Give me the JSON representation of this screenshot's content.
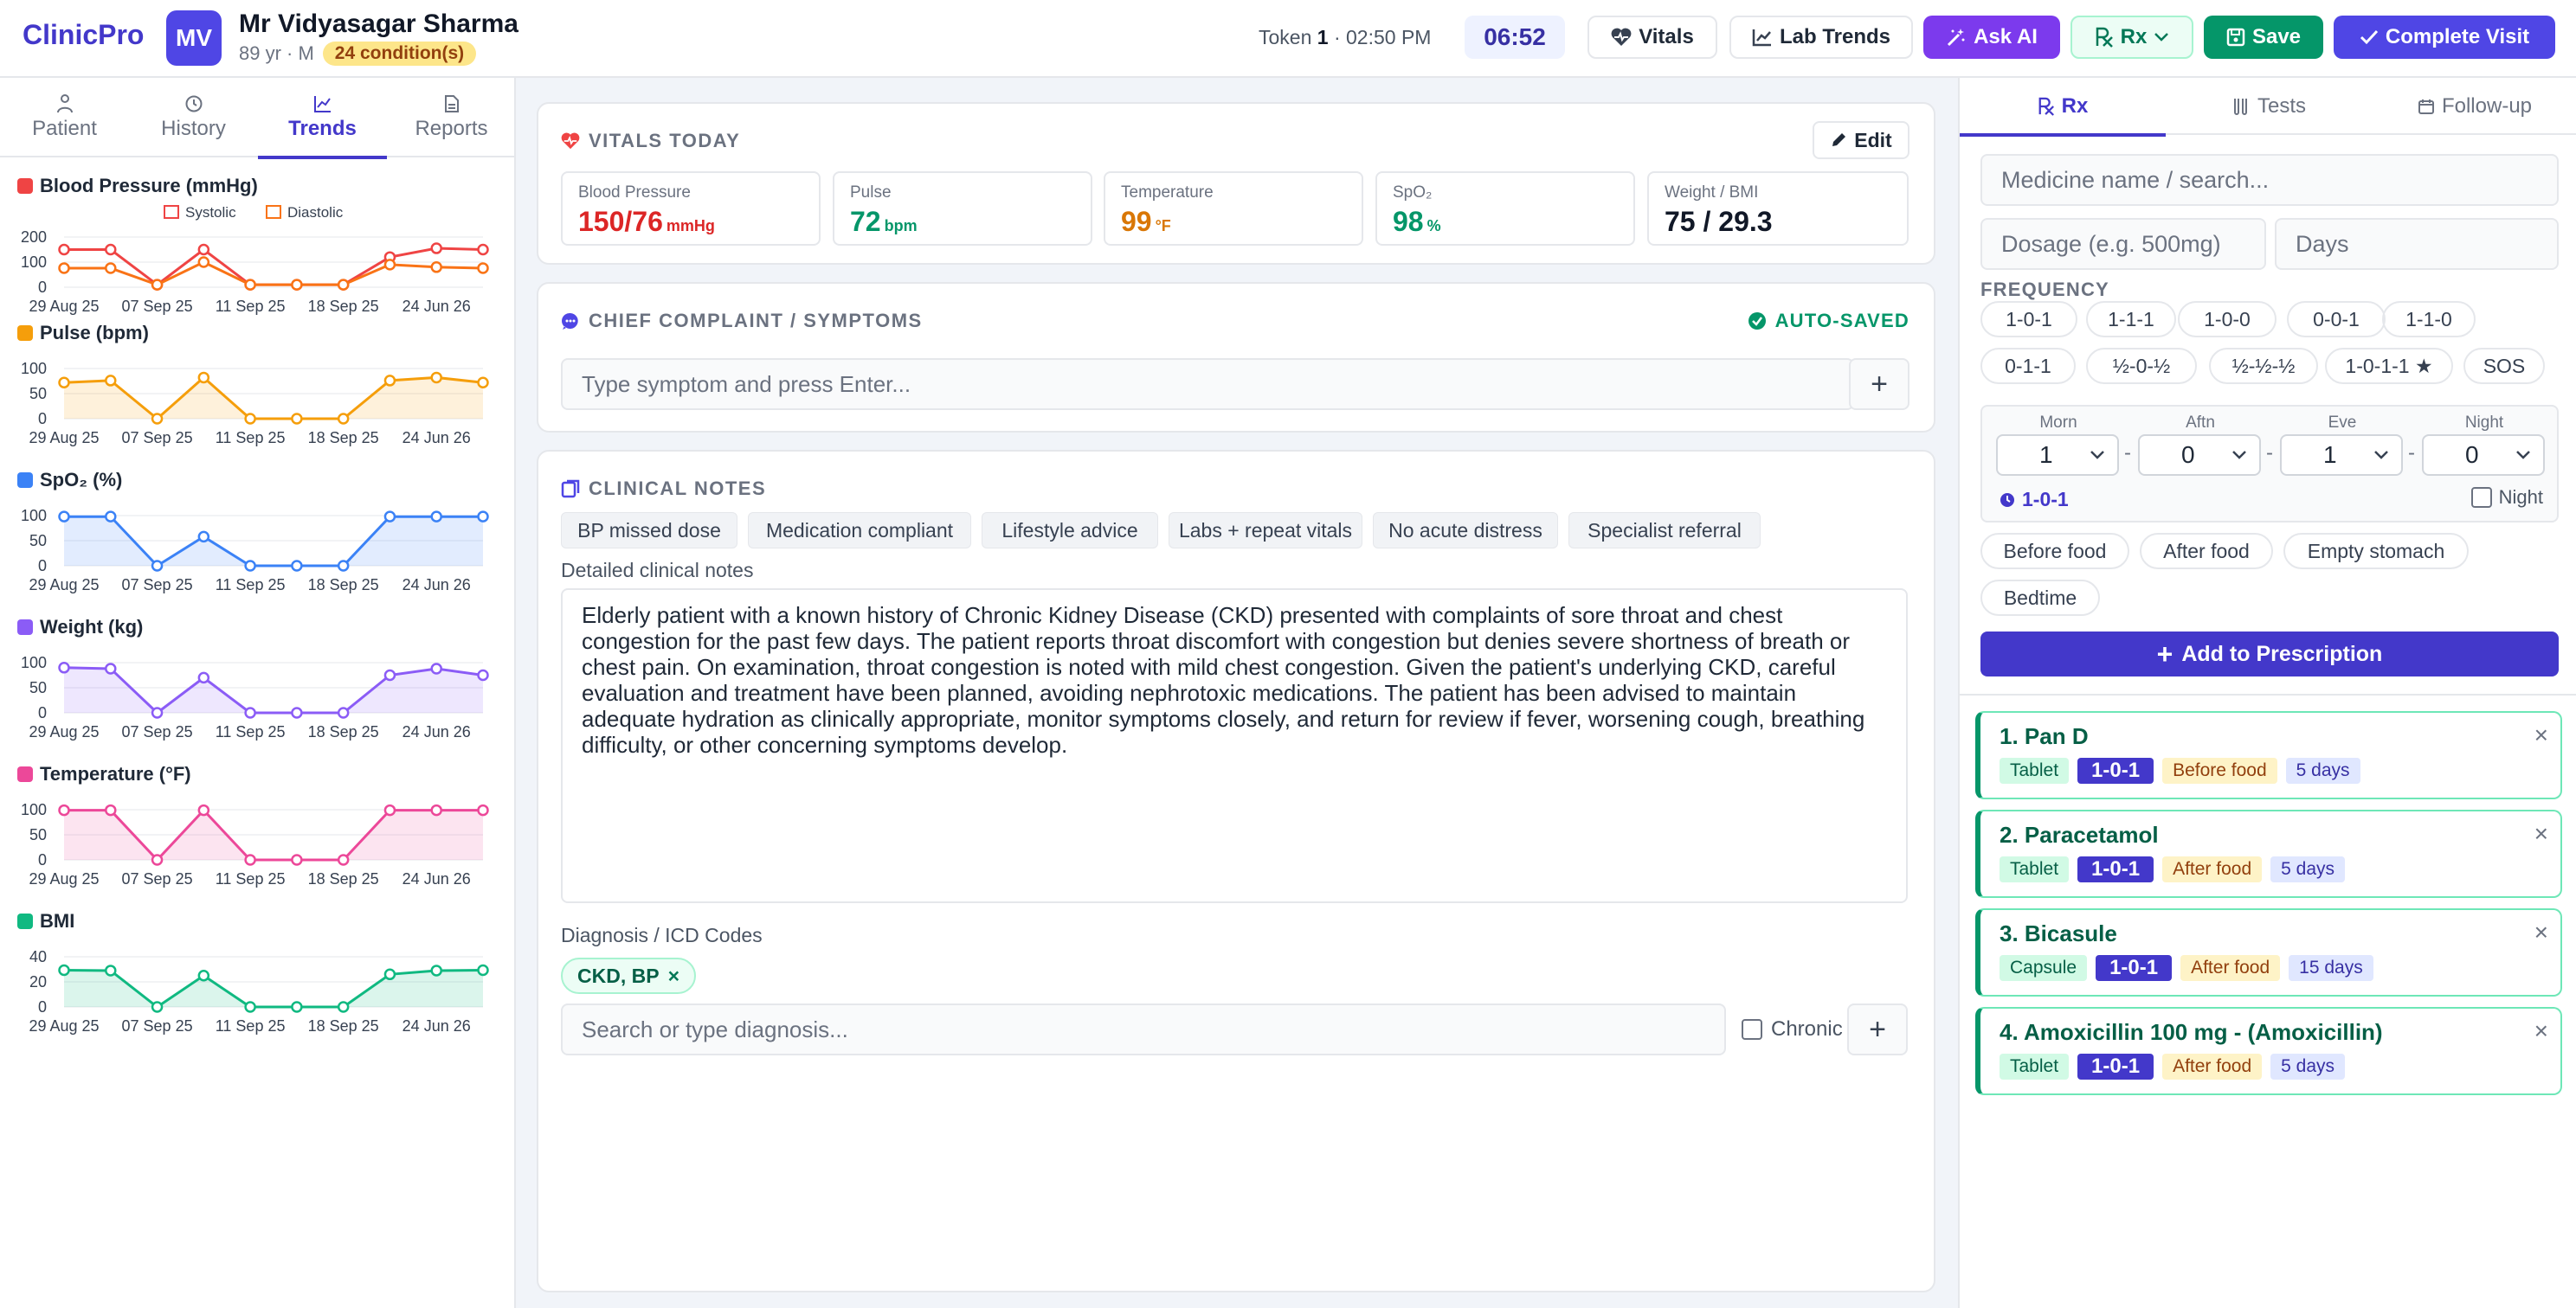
{
  "header": {
    "logo": "ClinicPro",
    "avatar_initials": "MV",
    "patient_name": "Mr Vidyasagar Sharma",
    "patient_meta": "89 yr · M",
    "conditions_badge": "24 condition(s)",
    "token_label": "Token",
    "token_number": "1",
    "time": "02:50 PM",
    "timer": "06:52",
    "buttons": {
      "vitals": "Vitals",
      "lab_trends": "Lab Trends",
      "ask_ai": "Ask AI",
      "rx": "Rx",
      "save": "Save",
      "complete_visit": "Complete Visit"
    }
  },
  "left_tabs": [
    {
      "label": "Patient",
      "icon": "person-icon"
    },
    {
      "label": "History",
      "icon": "history-icon"
    },
    {
      "label": "Trends",
      "icon": "chart-icon",
      "active": true
    },
    {
      "label": "Reports",
      "icon": "document-icon"
    }
  ],
  "chart_data": [
    {
      "type": "line",
      "title": "Blood Pressure (mmHg)",
      "color": "#ef4444",
      "ylim": [
        0,
        200
      ],
      "yticks": [
        200,
        100,
        0
      ],
      "x": [
        "29 Aug 25",
        "",
        "07 Sep 25",
        "",
        "11 Sep 25",
        "",
        "18 Sep 25",
        "",
        "24 Jun 26",
        ""
      ],
      "legend": [
        "Systolic",
        "Diastolic"
      ],
      "series": [
        {
          "name": "Systolic",
          "color": "#ef4444",
          "values": [
            150,
            150,
            10,
            150,
            10,
            10,
            10,
            120,
            155,
            150
          ]
        },
        {
          "name": "Diastolic",
          "color": "#f97316",
          "values": [
            76,
            76,
            10,
            100,
            10,
            10,
            10,
            90,
            80,
            76
          ]
        }
      ]
    },
    {
      "type": "area",
      "title": "Pulse (bpm)",
      "color": "#f59e0b",
      "ylim": [
        0,
        100
      ],
      "yticks": [
        100,
        50,
        0
      ],
      "x": [
        "29 Aug 25",
        "",
        "07 Sep 25",
        "",
        "11 Sep 25",
        "",
        "18 Sep 25",
        "",
        "24 Jun 26",
        ""
      ],
      "series": [
        {
          "color": "#f59e0b",
          "values": [
            72,
            76,
            0,
            82,
            0,
            0,
            0,
            76,
            82,
            72
          ]
        }
      ]
    },
    {
      "type": "area",
      "title": "SpO₂ (%)",
      "color": "#3b82f6",
      "ylim": [
        0,
        100
      ],
      "yticks": [
        100,
        50,
        0
      ],
      "x": [
        "29 Aug 25",
        "",
        "07 Sep 25",
        "",
        "11 Sep 25",
        "",
        "18 Sep 25",
        "",
        "24 Jun 26",
        ""
      ],
      "series": [
        {
          "color": "#3b82f6",
          "values": [
            98,
            98,
            0,
            58,
            0,
            0,
            0,
            98,
            98,
            98
          ]
        }
      ]
    },
    {
      "type": "area",
      "title": "Weight (kg)",
      "color": "#8b5cf6",
      "ylim": [
        0,
        100
      ],
      "yticks": [
        100,
        50,
        0
      ],
      "x": [
        "29 Aug 25",
        "",
        "07 Sep 25",
        "",
        "11 Sep 25",
        "",
        "18 Sep 25",
        "",
        "24 Jun 26",
        ""
      ],
      "series": [
        {
          "color": "#8b5cf6",
          "values": [
            90,
            88,
            0,
            70,
            0,
            0,
            0,
            75,
            88,
            75
          ]
        }
      ]
    },
    {
      "type": "area",
      "title": "Temperature (°F)",
      "color": "#ec4899",
      "ylim": [
        0,
        100
      ],
      "yticks": [
        100,
        50,
        0
      ],
      "x": [
        "29 Aug 25",
        "",
        "07 Sep 25",
        "",
        "11 Sep 25",
        "",
        "18 Sep 25",
        "",
        "24 Jun 26",
        ""
      ],
      "series": [
        {
          "color": "#ec4899",
          "values": [
            99,
            99,
            0,
            99,
            0,
            0,
            0,
            99,
            99,
            99
          ]
        }
      ]
    },
    {
      "type": "area",
      "title": "BMI",
      "color": "#10b981",
      "ylim": [
        0,
        40
      ],
      "yticks": [
        40,
        20,
        0
      ],
      "x": [
        "29 Aug 25",
        "",
        "07 Sep 25",
        "",
        "11 Sep 25",
        "",
        "18 Sep 25",
        "",
        "24 Jun 26",
        ""
      ],
      "series": [
        {
          "color": "#10b981",
          "values": [
            29.3,
            29,
            0,
            25,
            0,
            0,
            0,
            26,
            29,
            29.3
          ]
        }
      ]
    }
  ],
  "vitals": {
    "title": "VITALS TODAY",
    "edit_label": "Edit",
    "items": [
      {
        "label": "Blood Pressure",
        "value": "150/76",
        "unit": "mmHg",
        "color": "#dc2626"
      },
      {
        "label": "Pulse",
        "value": "72",
        "unit": "bpm",
        "color": "#059669"
      },
      {
        "label": "Temperature",
        "value": "99",
        "unit": "°F",
        "color": "#d97706"
      },
      {
        "label": "SpO₂",
        "value": "98",
        "unit": "%",
        "color": "#059669"
      },
      {
        "label": "Weight / BMI",
        "value": "75 / 29.3",
        "unit": "",
        "color": "#111827"
      }
    ]
  },
  "complaint": {
    "title": "CHIEF COMPLAINT / SYMPTOMS",
    "autosaved": "AUTO-SAVED",
    "placeholder": "Type symptom and press Enter..."
  },
  "notes": {
    "title": "CLINICAL NOTES",
    "quick_chips": [
      "BP missed dose",
      "Medication compliant",
      "Lifestyle advice",
      "Labs + repeat vitals",
      "No acute distress",
      "Specialist referral"
    ],
    "detail_label": "Detailed clinical notes",
    "text": "Elderly patient with a known history of Chronic Kidney Disease (CKD) presented with complaints of sore throat and chest congestion for the past few days. The patient reports throat discomfort with congestion but denies severe shortness of breath or chest pain. On examination, throat congestion is noted with mild chest congestion. Given the patient's underlying CKD, careful evaluation and treatment have been planned, avoiding nephrotoxic medications. The patient has been advised to maintain adequate hydration as clinically appropriate, monitor symptoms closely, and return for review if fever, worsening cough, breathing difficulty, or other concerning symptoms develop.",
    "diagnosis_label": "Diagnosis / ICD Codes",
    "diagnosis_chip": "CKD, BP",
    "diagnosis_placeholder": "Search or type diagnosis...",
    "chronic_label": "Chronic"
  },
  "rx_panel": {
    "tabs": [
      "Rx",
      "Tests",
      "Follow-up"
    ],
    "medicine_placeholder": "Medicine name / search...",
    "dosage_placeholder": "Dosage (e.g. 500mg)",
    "days_placeholder": "Days",
    "frequency_label": "FREQUENCY",
    "frequency_options": [
      "1-0-1",
      "1-1-1",
      "1-0-0",
      "0-0-1",
      "1-1-0",
      "0-1-1",
      "½-0-½",
      "½-½-½",
      "1-0-1-1 ★",
      "SOS"
    ],
    "dose": {
      "labels": [
        "Morn",
        "Aftn",
        "Eve",
        "Night"
      ],
      "values": [
        "1",
        "0",
        "1",
        "0"
      ],
      "result": "1-0-1",
      "night_label": "Night"
    },
    "timing_options": [
      "Before food",
      "After food",
      "Empty stomach",
      "Bedtime"
    ],
    "add_label": "Add to Prescription",
    "prescriptions": [
      {
        "name": "1. Pan D",
        "form": "Tablet",
        "dose": "1-0-1",
        "when": "Before food",
        "days": "5 days"
      },
      {
        "name": "2. Paracetamol",
        "form": "Tablet",
        "dose": "1-0-1",
        "when": "After food",
        "days": "5 days"
      },
      {
        "name": "3. Bicasule",
        "form": "Capsule",
        "dose": "1-0-1",
        "when": "After food",
        "days": "15 days"
      },
      {
        "name": "4. Amoxicillin 100 mg - (Amoxicillin)",
        "form": "Tablet",
        "dose": "1-0-1",
        "when": "After food",
        "days": "5 days"
      }
    ]
  }
}
